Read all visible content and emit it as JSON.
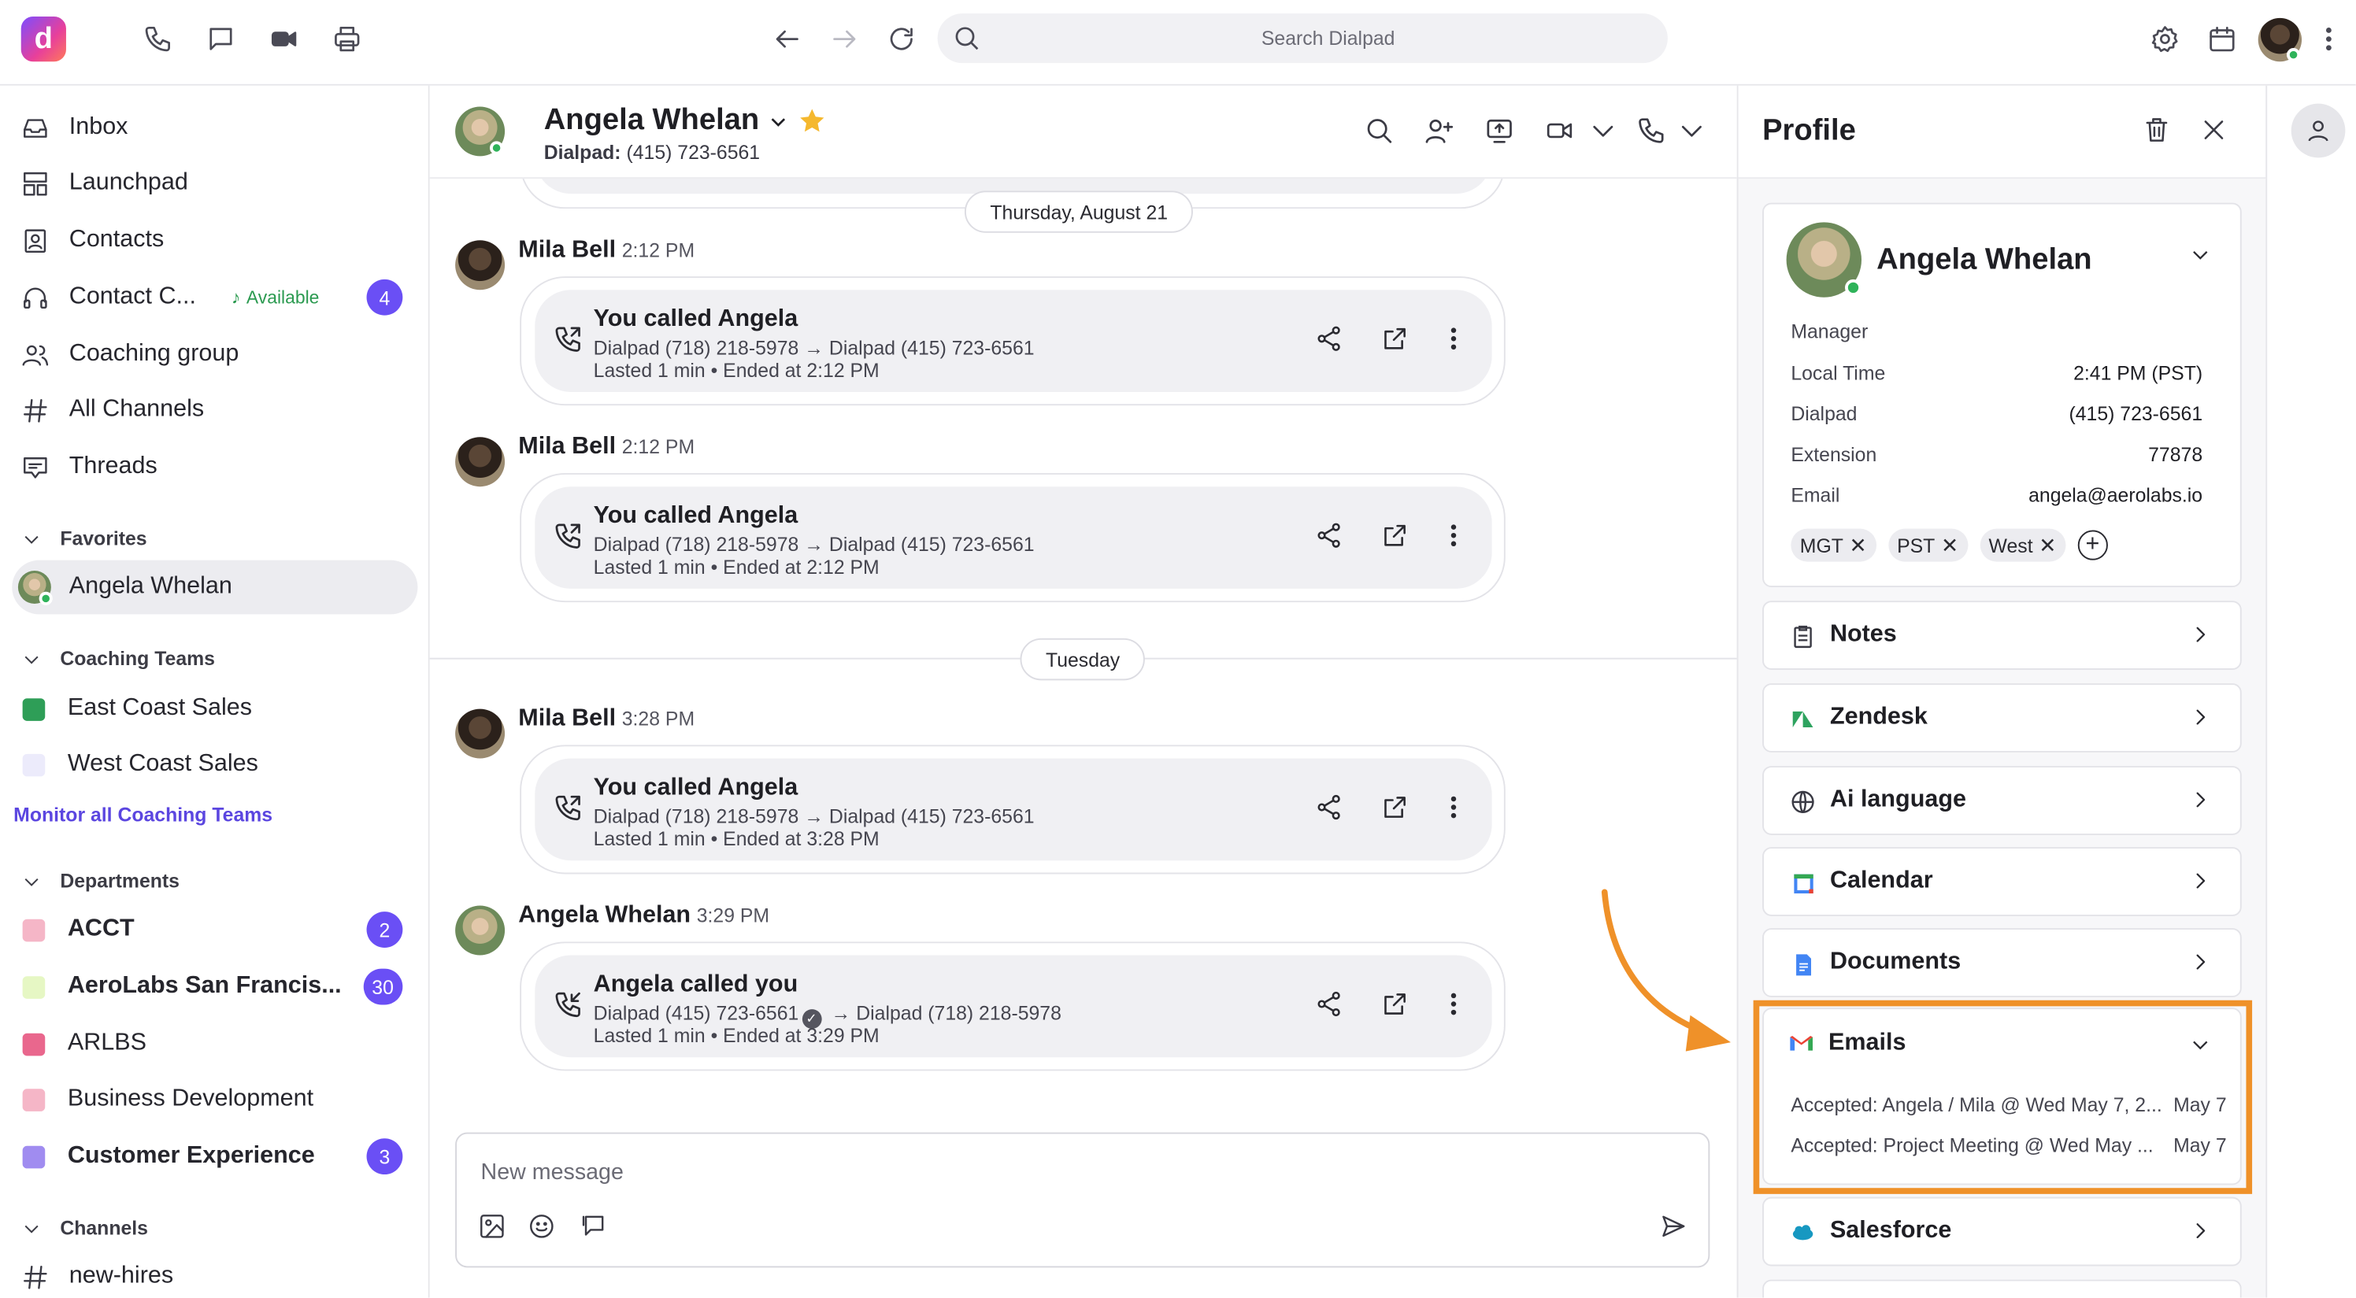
{
  "topbar": {
    "logo_letter": "d",
    "search_placeholder": "Search Dialpad",
    "icons": [
      "phone-icon",
      "chat-icon",
      "video-icon",
      "printer-icon",
      "back-arrow-icon",
      "forward-arrow-icon",
      "refresh-icon",
      "search-icon",
      "gear-icon",
      "calendar-icon",
      "more-icon"
    ]
  },
  "sidebar": {
    "nav": [
      {
        "label": "Inbox",
        "icon": "inbox-icon"
      },
      {
        "label": "Launchpad",
        "icon": "launchpad-icon"
      },
      {
        "label": "Contacts",
        "icon": "contacts-icon"
      },
      {
        "label": "Contact C...",
        "icon": "headset-icon",
        "status": "Available",
        "badge": "4"
      },
      {
        "label": "Coaching group",
        "icon": "people-icon"
      },
      {
        "label": "All Channels",
        "icon": "hash-icon"
      },
      {
        "label": "Threads",
        "icon": "threads-icon"
      }
    ],
    "favorites": {
      "header": "Favorites",
      "items": [
        {
          "label": "Angela Whelan"
        }
      ]
    },
    "coaching_teams": {
      "header": "Coaching Teams",
      "items": [
        {
          "label": "East Coast Sales",
          "color": "#2e9e57"
        },
        {
          "label": "West Coast Sales",
          "color": "#ecebfb"
        }
      ],
      "monitor_link": "Monitor all Coaching Teams"
    },
    "departments": {
      "header": "Departments",
      "items": [
        {
          "label": "ACCT",
          "color": "#f5b6c7",
          "badge": "2",
          "bold": true
        },
        {
          "label": "AeroLabs San Francis...",
          "color": "#e6f7c4",
          "badge": "30",
          "bold": true
        },
        {
          "label": "ARLBS",
          "color": "#e9678d",
          "bold": false
        },
        {
          "label": "Business Development",
          "color": "#f5b6c7",
          "bold": false
        },
        {
          "label": "Customer Experience",
          "color": "#a08cf0",
          "badge": "3",
          "bold": true
        }
      ]
    },
    "channels": {
      "header": "Channels",
      "items": [
        {
          "label": "new-hires"
        }
      ]
    }
  },
  "chat": {
    "contact_name": "Angela Whelan",
    "sub_label": "Dialpad:",
    "sub_value": "(415) 723-6561",
    "dates": [
      "Thursday, August 21",
      "Tuesday"
    ],
    "messages": [
      {
        "author": "Mila Bell",
        "time": "2:12 PM",
        "title": "You called Angela",
        "from": "Dialpad (718) 218-5978",
        "to": "Dialpad (415) 723-6561",
        "meta": "Lasted 1 min • Ended at 2:12 PM",
        "direction": "outgoing"
      },
      {
        "author": "Mila Bell",
        "time": "2:12 PM",
        "title": "You called Angela",
        "from": "Dialpad (718) 218-5978",
        "to": "Dialpad (415) 723-6561",
        "meta": "Lasted 1 min • Ended at 2:12 PM",
        "direction": "outgoing"
      },
      {
        "author": "Mila Bell",
        "time": "3:28 PM",
        "title": "You called Angela",
        "from": "Dialpad (718) 218-5978",
        "to": "Dialpad (415) 723-6561",
        "meta": "Lasted 1 min • Ended at 3:28 PM",
        "direction": "outgoing"
      },
      {
        "author": "Angela Whelan",
        "time": "3:29 PM",
        "title": "Angela called you",
        "from": "Dialpad (415) 723-6561",
        "to": "Dialpad (718) 218-5978",
        "meta": "Lasted 1 min • Ended at 3:29 PM",
        "direction": "incoming"
      }
    ],
    "composer_placeholder": "New message"
  },
  "profile": {
    "title": "Profile",
    "name": "Angela Whelan",
    "role": "Manager",
    "fields": [
      {
        "label": "Local Time",
        "value": "2:41 PM (PST)"
      },
      {
        "label": "Dialpad",
        "value": "(415) 723-6561"
      },
      {
        "label": "Extension",
        "value": "77878"
      },
      {
        "label": "Email",
        "value": "angela@aerolabs.io"
      }
    ],
    "tags": [
      "MGT",
      "PST",
      "West"
    ],
    "sections": [
      {
        "label": "Notes",
        "icon": "notes-icon"
      },
      {
        "label": "Zendesk",
        "icon": "zendesk-icon"
      },
      {
        "label": "Ai language",
        "icon": "globe-icon"
      },
      {
        "label": "Calendar",
        "icon": "google-calendar-icon"
      },
      {
        "label": "Documents",
        "icon": "docs-icon"
      }
    ],
    "emails": {
      "label": "Emails",
      "rows": [
        {
          "subject": "Accepted: Angela / Mila @ Wed May 7, 2...",
          "date": "May 7"
        },
        {
          "subject": "Accepted: Project Meeting @ Wed May ...",
          "date": "May 7"
        }
      ]
    },
    "after_sections": [
      {
        "label": "Salesforce",
        "icon": "salesforce-icon"
      }
    ]
  },
  "colors": {
    "accent": "#6a4ff5",
    "highlight": "#ef9129",
    "available": "#2fb35a"
  }
}
